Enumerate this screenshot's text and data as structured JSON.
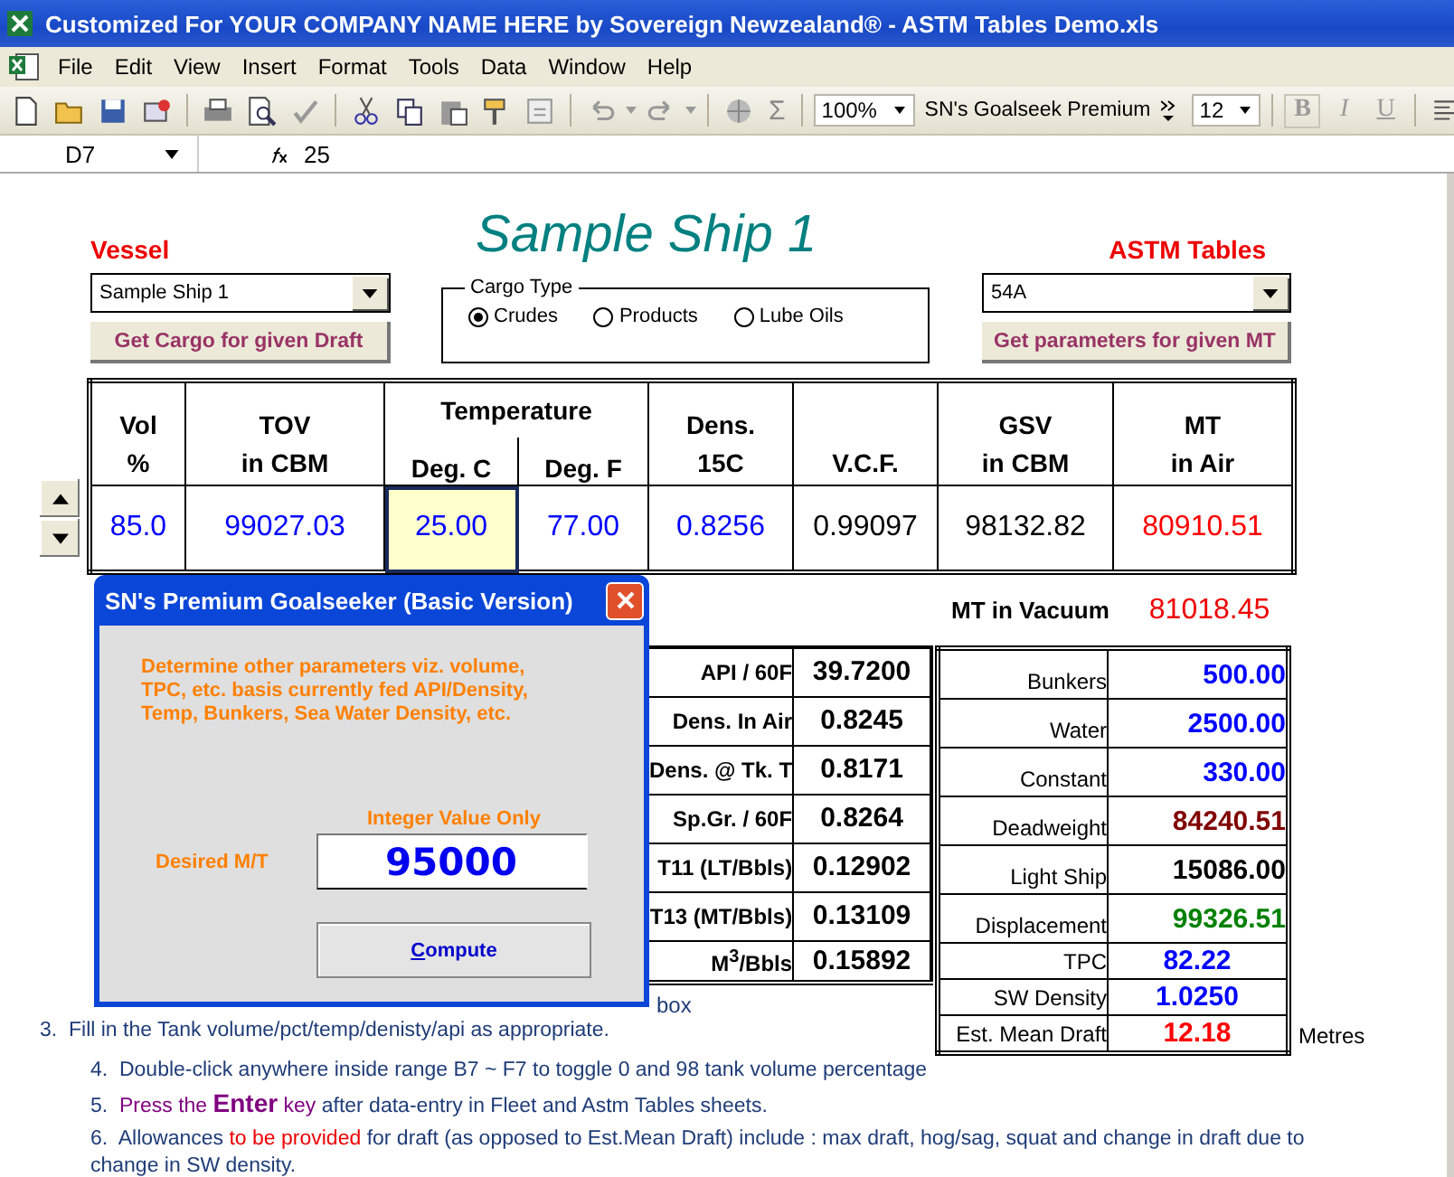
{
  "window": {
    "title": "Customized For YOUR COMPANY NAME HERE by Sovereign Newzealand® - ASTM Tables Demo.xls"
  },
  "menu": [
    "File",
    "Edit",
    "View",
    "Insert",
    "Format",
    "Tools",
    "Data",
    "Window",
    "Help"
  ],
  "toolbar": {
    "autosum": "Σ",
    "zoom": "100%",
    "font": "SN's Goalseek Premium",
    "font_size": "12",
    "format_buttons": [
      "B",
      "I",
      "U"
    ]
  },
  "formula_bar": {
    "cell": "D7",
    "formula": "25"
  },
  "sheet": {
    "title": "Sample Ship 1",
    "vessel": {
      "label": "Vessel",
      "value": "Sample Ship 1",
      "button": "Get Cargo for given Draft"
    },
    "cargo_type": {
      "legend": "Cargo Type",
      "options": [
        {
          "label": "Crudes",
          "selected": true
        },
        {
          "label": "Products",
          "selected": false
        },
        {
          "label": "Lube Oils",
          "selected": false
        }
      ]
    },
    "astm": {
      "label": "ASTM Tables",
      "value": "54A",
      "button": "Get parameters for given MT"
    },
    "main_table": {
      "columns": [
        {
          "kind": "single",
          "lines": [
            "Vol",
            "%"
          ]
        },
        {
          "kind": "single",
          "lines": [
            "TOV",
            "in CBM"
          ]
        },
        {
          "kind": "group",
          "label": "Temperature",
          "subcolumns": [
            "Deg. C",
            "Deg. F"
          ]
        },
        {
          "kind": "single",
          "lines": [
            "Dens.",
            "15C"
          ]
        },
        {
          "kind": "single",
          "lines": [
            "V.C.F."
          ]
        },
        {
          "kind": "single",
          "lines": [
            "GSV",
            "in CBM"
          ]
        },
        {
          "kind": "single",
          "lines": [
            "MT",
            "in Air"
          ]
        }
      ],
      "row": [
        {
          "value": "85.0",
          "color": "#0000ff",
          "selected": false
        },
        {
          "value": "99027.03",
          "color": "#0000ff",
          "selected": false
        },
        {
          "value": "25.00",
          "color": "#0000ff",
          "selected": true
        },
        {
          "value": "77.00",
          "color": "#0000ff",
          "selected": false
        },
        {
          "value": "0.8256",
          "color": "#0000ff",
          "selected": false
        },
        {
          "value": "0.99097",
          "color": "#000000",
          "selected": false
        },
        {
          "value": "98132.82",
          "color": "#000000",
          "selected": false
        },
        {
          "value": "80910.51",
          "color": "#ff0000",
          "selected": false
        }
      ]
    },
    "vacuum": {
      "label": "MT in Vacuum",
      "value": "81018.45"
    },
    "params": [
      {
        "label": "API / 60F",
        "value": "39.7200"
      },
      {
        "label": "Dens. In Air",
        "value": "0.8245"
      },
      {
        "label": "Dens. @ Tk. T",
        "value": "0.8171"
      },
      {
        "label": "Sp.Gr.  / 60F",
        "value": "0.8264"
      },
      {
        "label": "T11 (LT/Bbls)",
        "value": "0.12902"
      },
      {
        "label": "T13 (MT/Bbls)",
        "value": "0.13109"
      },
      {
        "label": "M$^{3}$/Bbls",
        "value": "0.15892"
      }
    ],
    "loading": [
      {
        "kind": "tall",
        "label": "Bunkers",
        "value": "500.00",
        "color": "#0000ff"
      },
      {
        "kind": "tall",
        "label": "Water",
        "value": "2500.00",
        "color": "#0000ff"
      },
      {
        "kind": "tall",
        "label": "Constant",
        "value": "330.00",
        "color": "#0000ff"
      },
      {
        "kind": "tall",
        "label": "Deadweight",
        "value": "84240.51",
        "color": "#800000"
      },
      {
        "kind": "tall",
        "label": "Light Ship",
        "value": "15086.00",
        "color": "#000000"
      },
      {
        "kind": "tall",
        "label": "Displacement",
        "value": "99326.51",
        "color": "#008000"
      },
      {
        "kind": "short",
        "label": "TPC",
        "value": "82.22",
        "color": "#0000ff"
      },
      {
        "kind": "short",
        "label": "SW Density",
        "value": "1.0250",
        "color": "#0000ff"
      },
      {
        "kind": "short",
        "label": "Est. Mean Draft",
        "value": "12.18",
        "color": "#ff0000"
      }
    ],
    "draft_unit": "Metres",
    "note_fragment": "box",
    "notes": [
      {
        "number": "3.",
        "parts": [
          {
            "kind": "plain",
            "text": "Fill in the Tank volume/pct/temp/denisty/api as appropriate."
          }
        ]
      },
      {
        "number": "4.",
        "parts": [
          {
            "kind": "plain",
            "text": "Double-click anywhere inside range B7 ~ F7 to toggle 0 and 98 tank volume percentage"
          }
        ]
      },
      {
        "number": "5.",
        "parts": [
          {
            "kind": "emphasis",
            "text": "Press the "
          },
          {
            "kind": "key",
            "text": "Enter"
          },
          {
            "kind": "emphasis",
            "text": " key"
          },
          {
            "kind": "plain",
            "text": " after data-entry in Fleet and Astm Tables sheets."
          }
        ]
      },
      {
        "number": "6.",
        "parts": [
          {
            "kind": "plain",
            "text": "Allowances "
          },
          {
            "kind": "warning",
            "text": "to be provided"
          },
          {
            "kind": "plain",
            "text": " for draft (as opposed to Est.Mean Draft) include :  max draft, hog/sag, squat and change in draft due to change in SW density."
          }
        ]
      }
    ]
  },
  "dialog": {
    "title": "SN's Premium Goalseeker (Basic Version)",
    "message": "Determine other parameters viz. volume, TPC, etc. basis currently fed API/Density, Temp, Bunkers, Sea Water Density, etc.",
    "hint": "Integer Value Only",
    "field_label": "Desired M/T",
    "value": "95000",
    "button": "Compute"
  }
}
